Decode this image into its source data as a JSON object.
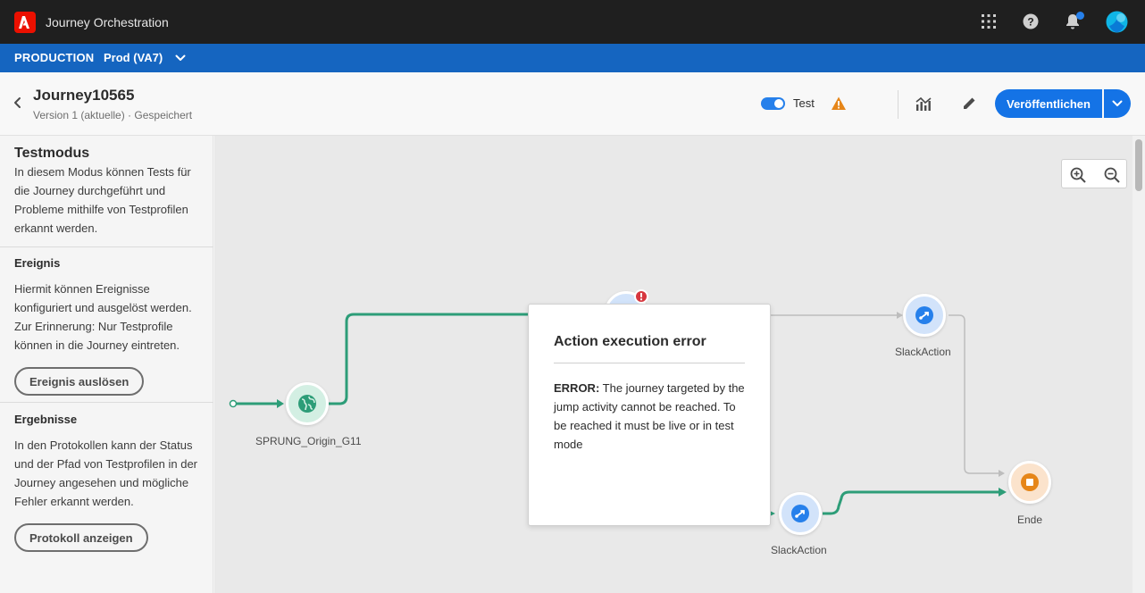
{
  "app": {
    "title": "Journey Orchestration"
  },
  "env": {
    "label": "PRODUCTION",
    "sandbox": "Prod (VA7)"
  },
  "header": {
    "title": "Journey10565",
    "subtitle": "Version 1 (aktuelle) · Gespeichert",
    "test_label": "Test",
    "test_enabled": true,
    "publish_label": "Veröffentlichen"
  },
  "left_panel": {
    "title": "Testmodus",
    "intro": "In diesem Modus können Tests für die Journey durchgeführt und Probleme mithilfe von Testprofilen erkannt werden.",
    "event_heading": "Ereignis",
    "event_text": "Hiermit können Ereignisse konfiguriert und ausgelöst werden. Zur Erinnerung: Nur Testprofile können in die Journey eintreten.",
    "event_button": "Ereignis auslösen",
    "results_heading": "Ergebnisse",
    "results_text": "In den Protokollen kann der Status und der Pfad von Testprofilen in der Journey angesehen und mögliche Fehler erkannt werden.",
    "results_button": "Protokoll anzeigen"
  },
  "canvas": {
    "nodes": {
      "origin": "SPRUNG_Origin_G11",
      "slack_top": "SlackAction",
      "slack_bottom": "SlackAction",
      "end": "Ende"
    }
  },
  "error_popover": {
    "title": "Action execution error",
    "prefix": "ERROR:",
    "message": "The journey targeted by the jump activity cannot be reached. To be reached it must be live or in test mode"
  },
  "colors": {
    "topbar": "#1f1f1f",
    "envbar": "#1565c0",
    "accent": "#1473e6",
    "path_green": "#2d9d78",
    "error_red": "#d7373f",
    "warning_orange": "#e68619"
  }
}
